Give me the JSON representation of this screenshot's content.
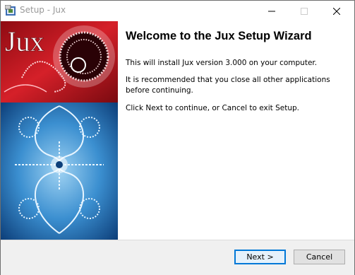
{
  "window": {
    "title": "Setup - Jux",
    "icon": "installer-icon"
  },
  "side_image": {
    "logo_text": "Jux"
  },
  "content": {
    "heading": "Welcome to the Jux Setup Wizard",
    "paragraph_1": "This will install Jux version 3.000 on your computer.",
    "paragraph_2": "It is recommended that you close all other applications before continuing.",
    "paragraph_3": "Click Next to continue, or Cancel to exit Setup."
  },
  "buttons": {
    "next": "Next >",
    "cancel": "Cancel"
  },
  "colors": {
    "accent": "#0078d7",
    "image_red": "#b3141c",
    "image_blue": "#3b8fd0"
  }
}
